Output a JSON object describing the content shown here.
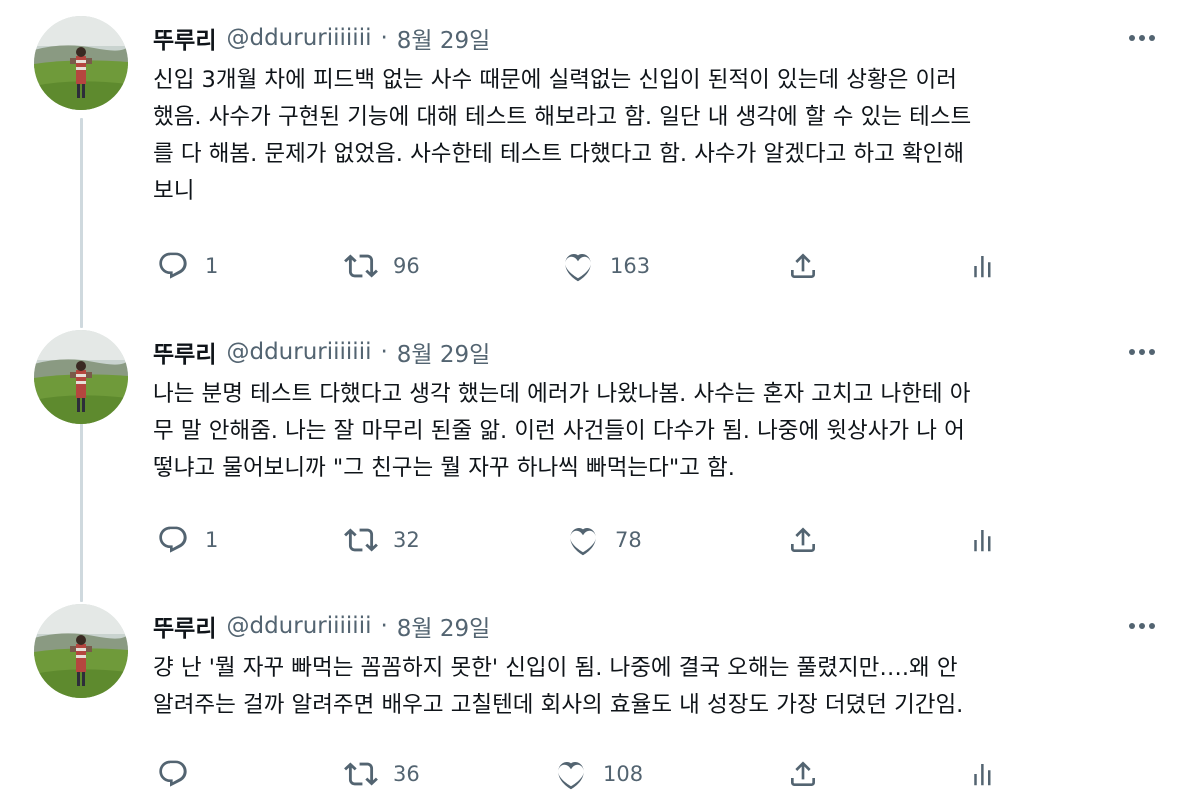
{
  "tweets": [
    {
      "name": "뚜루리",
      "handle": "@ddururiiiiiii",
      "separator": "·",
      "date": "8월 29일",
      "text": "신입 3개월 차에 피드백 없는 사수 때문에 실력없는 신입이 된적이 있는데 상황은 이러\n했음. 사수가 구현된 기능에 대해 테스트 해보라고 함. 일단 내 생각에 할 수 있는 테스트\n를 다 해봄. 문제가 없었음. 사수한테 테스트 다했다고 함. 사수가 알겠다고 하고 확인해\n보니",
      "replies": "1",
      "retweets": "96",
      "likes": "163"
    },
    {
      "name": "뚜루리",
      "handle": "@ddururiiiiiii",
      "separator": "·",
      "date": "8월 29일",
      "text": "나는 분명 테스트 다했다고 생각 했는데 에러가 나왔나봄. 사수는 혼자 고치고 나한테 아\n무 말 안해줌. 나는 잘 마무리 된줄 앎. 이런 사건들이 다수가 됨. 나중에 윗상사가 나 어\n떻냐고 물어보니까 \"그 친구는 뭘 자꾸 하나씩 빠먹는다\"고 함.",
      "replies": "1",
      "retweets": "32",
      "likes": "78"
    },
    {
      "name": "뚜루리",
      "handle": "@ddururiiiiiii",
      "separator": "·",
      "date": "8월 29일",
      "text": "걍 난 '뭘 자꾸 빠먹는 꼼꼼하지 못한' 신입이 됨. 나중에 결국 오해는 풀렸지만….왜 안\n알려주는 걸까 알려주면 배우고 고칠텐데 회사의 효율도 내 성장도 가장 더뎠던 기간임.",
      "replies": "",
      "retweets": "36",
      "likes": "108"
    }
  ],
  "icons": {
    "reply": "reply-icon",
    "retweet": "retweet-icon",
    "like": "heart-icon",
    "share": "share-icon",
    "analytics": "analytics-icon",
    "more": "more-icon"
  },
  "colors": {
    "text": "#0f1419",
    "secondary": "#536471",
    "thread_line": "#cfd9de"
  }
}
